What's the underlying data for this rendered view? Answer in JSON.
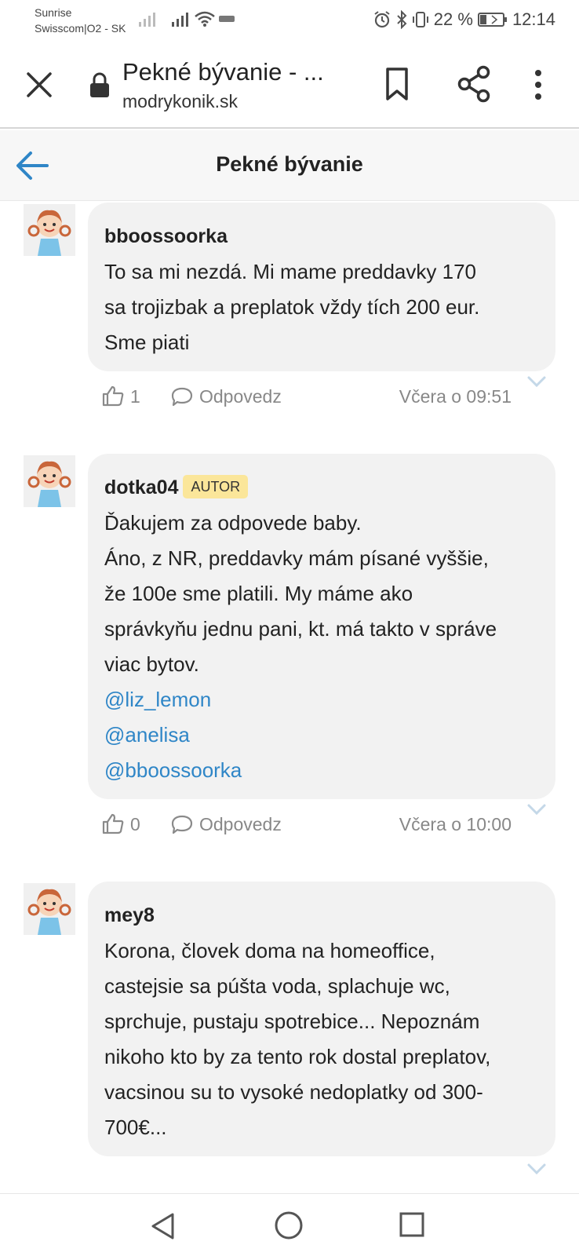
{
  "status": {
    "carrier_1": "Sunrise",
    "carrier_2": "Swisscom|O2 - SK",
    "battery": "22 %",
    "clock": "12:14"
  },
  "browser": {
    "page_title": "Pekné bývanie - ...",
    "url": "modrykonik.sk"
  },
  "header": {
    "title": "Pekné bývanie"
  },
  "comments": [
    {
      "username": "bboossoorka",
      "text_lines": [
        "To sa mi nezdá. Mi mame preddavky 170",
        "sa trojizbak a preplatok vždy tích 200 eur.",
        "Sme piati"
      ],
      "likes": "1",
      "reply_label": "Odpovedz",
      "time": "Včera o 09:51"
    },
    {
      "username": "dotka04",
      "badge": "AUTOR",
      "text_lines": [
        "Ďakujem za odpovede baby.",
        "Áno, z NR, preddavky mám písané vyššie,",
        "že 100e sme platili. My máme ako",
        "správkyňu jednu pani, kt. má takto v správe",
        "viac bytov."
      ],
      "mentions": [
        "@liz_lemon",
        "@anelisa",
        "@bboossoorka"
      ],
      "likes": "0",
      "reply_label": "Odpovedz",
      "time": "Včera o 10:00"
    },
    {
      "username": "mey8",
      "text_lines": [
        "Korona, človek doma na homeoffice,",
        "castejsie sa púšta voda, splachuje wc,",
        "sprchuje, pustaju spotrebice... Nepoznám",
        "nikoho kto by za tento rok dostal preplatov,",
        "vacsinou su to vysoké nedoplatky od 300-",
        "700€..."
      ]
    }
  ],
  "colors": {
    "link": "#2f86c7",
    "accent_arrow": "#2f86c7",
    "badge_bg": "#fbe69a",
    "bubble_bg": "#f2f2f2"
  }
}
